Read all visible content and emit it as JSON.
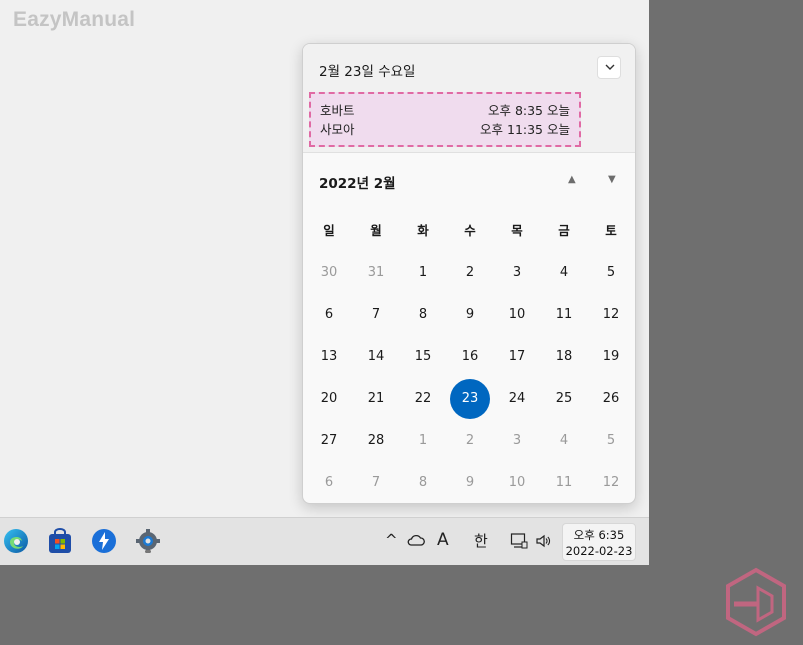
{
  "watermark": "EazyManual",
  "flyout": {
    "date_title": "2월 23일 수요일",
    "collapse_icon": "chevron-down-icon",
    "holidays": [
      {
        "name": "호바트",
        "time": "오후 8:35 오늘"
      },
      {
        "name": "사모아",
        "time": "오후 11:35 오늘"
      }
    ],
    "month_title": "2022년 2월",
    "nav_up": "▲",
    "nav_down": "▼",
    "weekdays": [
      "일",
      "월",
      "화",
      "수",
      "목",
      "금",
      "토"
    ],
    "days": [
      [
        "30",
        "31",
        "1",
        "2",
        "3",
        "4",
        "5"
      ],
      [
        "6",
        "7",
        "8",
        "9",
        "10",
        "11",
        "12"
      ],
      [
        "13",
        "14",
        "15",
        "16",
        "17",
        "18",
        "19"
      ],
      [
        "20",
        "21",
        "22",
        "23",
        "24",
        "25",
        "26"
      ],
      [
        "27",
        "28",
        "1",
        "2",
        "3",
        "4",
        "5"
      ],
      [
        "6",
        "7",
        "8",
        "9",
        "10",
        "11",
        "12"
      ]
    ],
    "selected_day": "23"
  },
  "taskbar": {
    "apps": [
      "edge-icon",
      "store-icon",
      "quick-assist-icon",
      "settings-icon"
    ],
    "tray": {
      "chevron": "^",
      "onedrive_icon": "cloud-icon",
      "ime_mode": "A",
      "ime_lang": "한",
      "network_icon": "network-icon",
      "volume_icon": "volume-icon"
    },
    "clock_time": "오후 6:35",
    "clock_date": "2022-02-23"
  },
  "colors": {
    "accent": "#0067c0",
    "holiday_highlight": "#f0dcee",
    "holiday_border": "#e06aa4",
    "logo": "#c06680"
  }
}
